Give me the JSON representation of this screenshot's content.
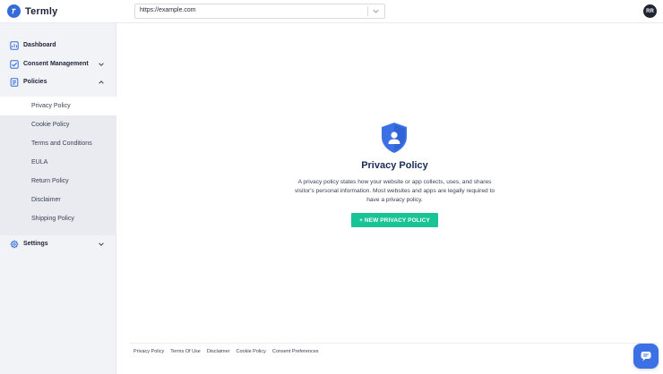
{
  "app": {
    "brand": "Termly"
  },
  "header": {
    "url_value": "https://example.com",
    "avatar_initials": "RR"
  },
  "sidebar": {
    "items": [
      {
        "label": "Dashboard",
        "icon": "dashboard-icon"
      },
      {
        "label": "Consent Management",
        "icon": "check-square-icon"
      },
      {
        "label": "Policies",
        "icon": "document-icon"
      },
      {
        "label": "Settings",
        "icon": "gear-icon"
      }
    ],
    "policies_sub": [
      {
        "label": "Privacy Policy",
        "active": true
      },
      {
        "label": "Cookie Policy"
      },
      {
        "label": "Terms and Conditions"
      },
      {
        "label": "EULA"
      },
      {
        "label": "Return Policy"
      },
      {
        "label": "Disclaimer"
      },
      {
        "label": "Shipping Policy"
      }
    ]
  },
  "main": {
    "icon": "shield-user-icon",
    "title": "Privacy Policy",
    "description": "A privacy policy states how your website or app collects, uses, and shares visitor's personal information. Most websites and apps are legally required to have a privacy policy.",
    "cta_label": "+ NEW PRIVACY POLICY"
  },
  "footer": {
    "links": [
      "Privacy Policy",
      "Terms Of Use",
      "Disclaimer",
      "Cookie Policy",
      "Consent Preferences"
    ]
  },
  "colors": {
    "brand": "#356bd8",
    "cta": "#18c395",
    "chat": "#3c71e6",
    "sidebar_bg": "#f2f3f6"
  }
}
